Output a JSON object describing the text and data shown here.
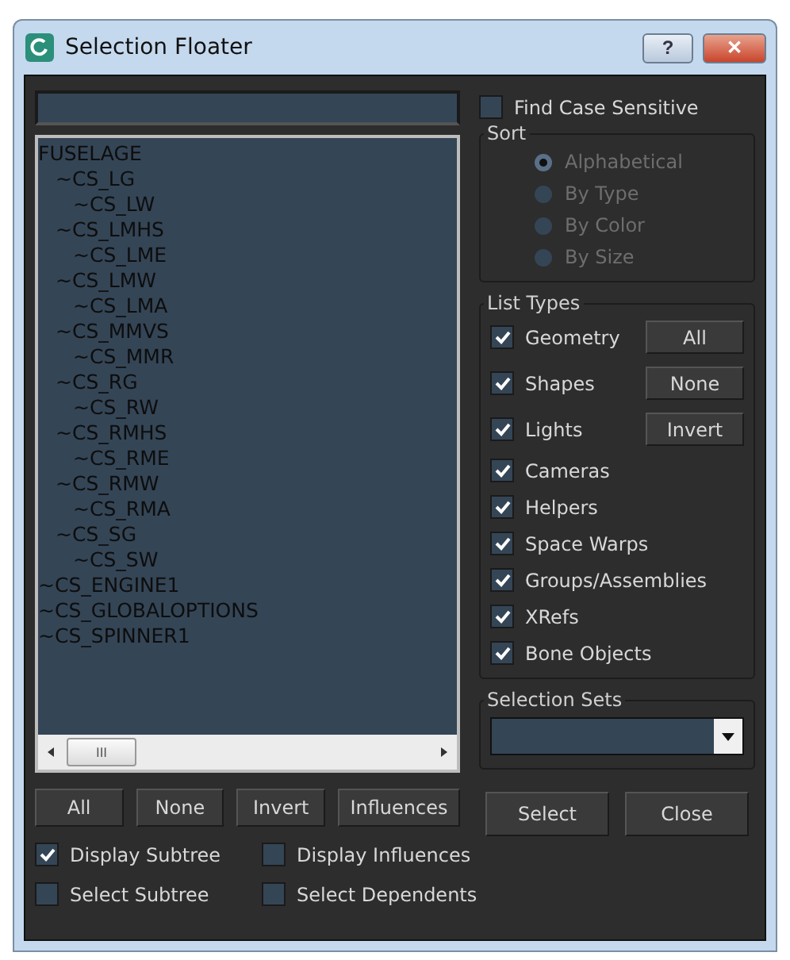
{
  "window": {
    "title": "Selection Floater"
  },
  "title_buttons": [
    {
      "kind": "help",
      "label": "?"
    },
    {
      "kind": "close",
      "label": "✕"
    }
  ],
  "find_case_sensitive": {
    "label": "Find Case Sensitive",
    "checked": false
  },
  "tree": [
    {
      "label": "FUSELAGE",
      "children": [
        {
          "label": "~CS_LG",
          "children": [
            {
              "label": "~CS_LW"
            }
          ]
        },
        {
          "label": "~CS_LMHS",
          "children": [
            {
              "label": "~CS_LME"
            }
          ]
        },
        {
          "label": "~CS_LMW",
          "children": [
            {
              "label": "~CS_LMA"
            }
          ]
        },
        {
          "label": "~CS_MMVS",
          "children": [
            {
              "label": "~CS_MMR"
            }
          ]
        },
        {
          "label": "~CS_RG",
          "children": [
            {
              "label": "~CS_RW"
            }
          ]
        },
        {
          "label": "~CS_RMHS",
          "children": [
            {
              "label": "~CS_RME"
            }
          ]
        },
        {
          "label": "~CS_RMW",
          "children": [
            {
              "label": "~CS_RMA"
            }
          ]
        },
        {
          "label": "~CS_SG",
          "children": [
            {
              "label": "~CS_SW"
            }
          ]
        }
      ]
    },
    {
      "label": "~CS_ENGINE1"
    },
    {
      "label": "~CS_GLOBALOPTIONS"
    },
    {
      "label": "~CS_SPINNER1"
    }
  ],
  "scrollbar": {
    "grip": "III"
  },
  "list_buttons": [
    "All",
    "None",
    "Invert",
    "Influences"
  ],
  "options": [
    {
      "label": "Display Subtree",
      "checked": true
    },
    {
      "label": "Display Influences",
      "checked": false
    },
    {
      "label": "Select Subtree",
      "checked": false
    },
    {
      "label": "Select Dependents",
      "checked": false
    }
  ],
  "sort": {
    "title": "Sort",
    "disabled": true,
    "options": [
      {
        "label": "Alphabetical",
        "selected": true
      },
      {
        "label": "By Type",
        "selected": false
      },
      {
        "label": "By Color",
        "selected": false
      },
      {
        "label": "By Size",
        "selected": false
      }
    ]
  },
  "list_types": {
    "title": "List Types",
    "items": [
      {
        "label": "Geometry",
        "checked": true
      },
      {
        "label": "Shapes",
        "checked": true
      },
      {
        "label": "Lights",
        "checked": true
      },
      {
        "label": "Cameras",
        "checked": true
      },
      {
        "label": "Helpers",
        "checked": true
      },
      {
        "label": "Space Warps",
        "checked": true
      },
      {
        "label": "Groups/Assemblies",
        "checked": true
      },
      {
        "label": "XRefs",
        "checked": true
      },
      {
        "label": "Bone Objects",
        "checked": true
      }
    ],
    "buttons": [
      "All",
      "None",
      "Invert"
    ]
  },
  "selection_sets": {
    "title": "Selection Sets"
  },
  "buttons": [
    "Select",
    "Close"
  ]
}
